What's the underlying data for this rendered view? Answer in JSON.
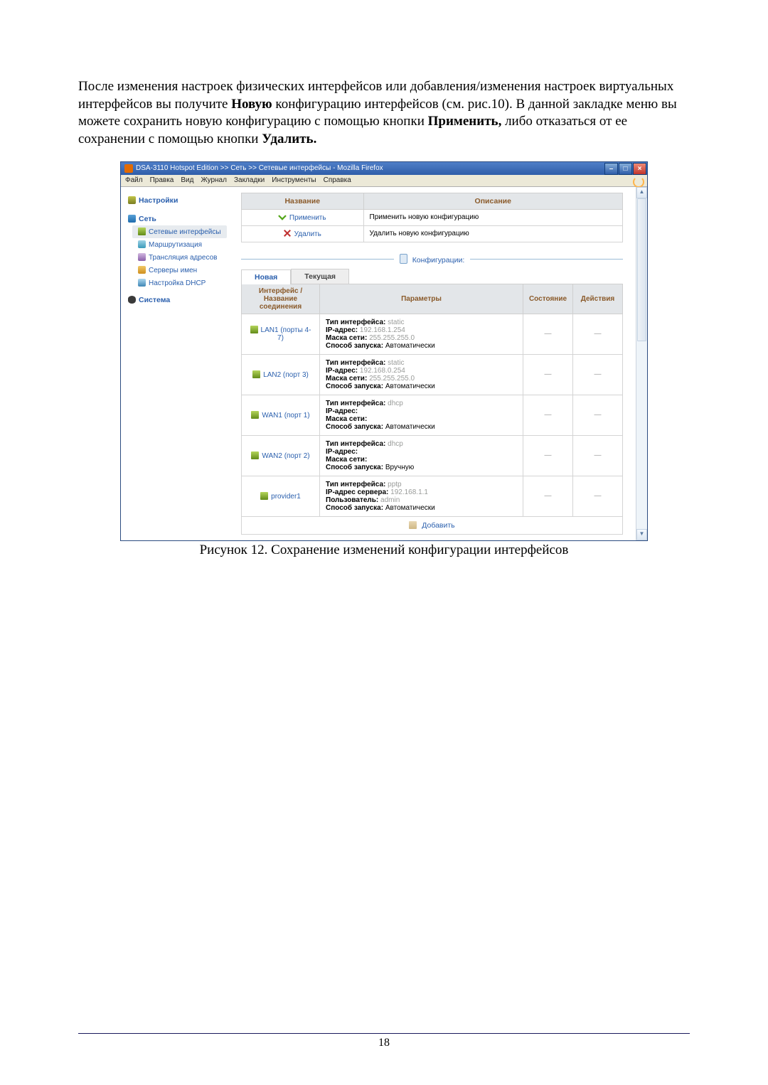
{
  "body_text_html": "После изменения настроек физических интерфейсов или добавления/изменения настроек виртуальных интерфейсов вы получите <b>Новую</b> конфигурацию интерфейсов (см. рис.10). В данной закладке меню вы можете сохранить новую конфигурацию с помощью кнопки <b>Применить,</b> либо отказаться от ее сохранении с помощью кнопки <b>Удалить.</b>",
  "caption": "Рисунок 12. Сохранение изменений конфигурации интерфейсов",
  "page_number": "18",
  "browser": {
    "title": "DSA-3110 Hotspot Edition >> Сеть >> Сетевые интерфейсы - Mozilla Firefox",
    "menus": [
      "Файл",
      "Правка",
      "Вид",
      "Журнал",
      "Закладки",
      "Инструменты",
      "Справка"
    ]
  },
  "sidebar": {
    "settings": "Настройки",
    "network": "Сеть",
    "items": [
      "Сетевые интерфейсы",
      "Маршрутизация",
      "Трансляция адресов",
      "Серверы имен",
      "Настройка DHCP"
    ],
    "system": "Система"
  },
  "actions": {
    "hdr_name": "Название",
    "hdr_desc": "Описание",
    "apply": "Применить",
    "apply_desc": "Применить новую конфигурацию",
    "delete": "Удалить",
    "delete_desc": "Удалить новую конфигурацию"
  },
  "config_label": "Конфигурации:",
  "tabs": {
    "new": "Новая",
    "current": "Текущая"
  },
  "iface_hdr": {
    "name": "Интерфейс / Название соединения",
    "params": "Параметры",
    "state": "Состояние",
    "act": "Действия"
  },
  "param_labels": {
    "type": "Тип интерфейса:",
    "ip": "IP-адрес:",
    "ip_srv": "IP-адрес сервера:",
    "mask": "Маска сети:",
    "user": "Пользователь:",
    "mode": "Способ запуска:"
  },
  "ifaces": [
    {
      "name": "LAN1 (порты 4-7)",
      "type": "static",
      "ip": "192.168.1.254",
      "mask": "255.255.255.0",
      "mode": "Автоматически"
    },
    {
      "name": "LAN2 (порт 3)",
      "type": "static",
      "ip": "192.168.0.254",
      "mask": "255.255.255.0",
      "mode": "Автоматически"
    },
    {
      "name": "WAN1 (порт 1)",
      "type": "dhcp",
      "ip": "",
      "mask": "",
      "mode": "Автоматически"
    },
    {
      "name": "WAN2 (порт 2)",
      "type": "dhcp",
      "ip": "",
      "mask": "",
      "mode": "Вручную"
    }
  ],
  "provider": {
    "name": "provider1",
    "type": "pptp",
    "ip_srv": "192.168.1.1",
    "user": "admin",
    "mode": "Автоматически"
  },
  "add_label": "Добавить"
}
